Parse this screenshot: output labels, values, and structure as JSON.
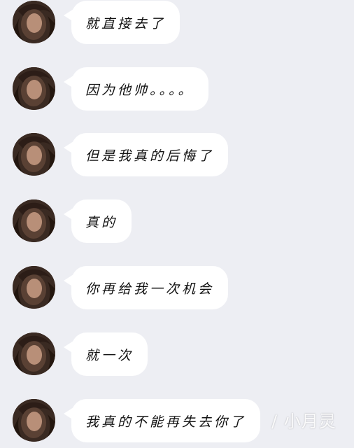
{
  "messages": [
    {
      "text": "就直接去了"
    },
    {
      "text": "因为他帅。。。。"
    },
    {
      "text": "但是我真的后悔了"
    },
    {
      "text": "真的"
    },
    {
      "text": "你再给我一次机会"
    },
    {
      "text": "就一次"
    },
    {
      "text": "我真的不能再失去你了"
    }
  ],
  "watermark": "/ 小月灵",
  "avatar_icon": "profile-photo-avatar",
  "colors": {
    "background": "#edeef3",
    "bubble": "#ffffff",
    "text": "#111111"
  }
}
